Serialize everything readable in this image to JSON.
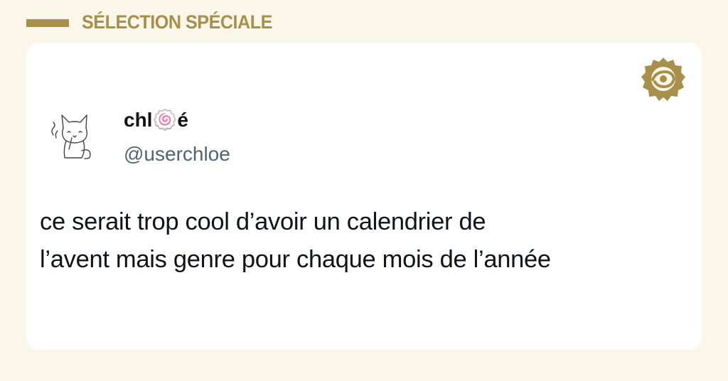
{
  "header": {
    "title": "SÉLECTION SPÉCIALE",
    "accent_color": "#a8904a"
  },
  "badge": {
    "icon": "site-logo-icon"
  },
  "post": {
    "author_name": "chl🍥é",
    "author_handle": "@userchloe",
    "avatar_icon": "cat-avatar-icon",
    "text_lines": [
      "ce serait trop cool d’avoir un calendrier de",
      "l’avent mais genre pour chaque mois de l’année"
    ]
  }
}
